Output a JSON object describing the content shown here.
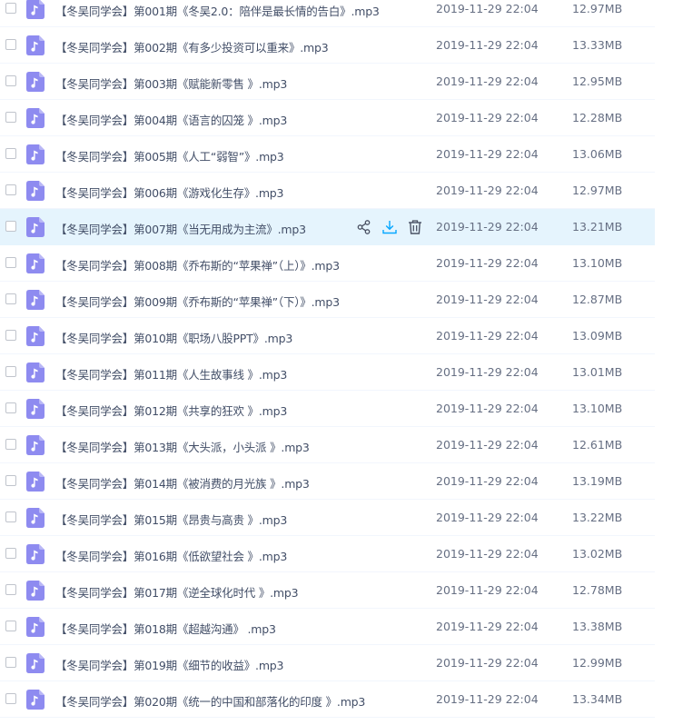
{
  "colors": {
    "accent": "#8E8BF0",
    "hover_bg": "#E5F4FD",
    "download_blue": "#06A7FF",
    "icon_gray": "#4A5163"
  },
  "file_icon": "music-file-icon",
  "hover_actions": [
    "share-icon",
    "download-icon",
    "delete-icon"
  ],
  "files": [
    {
      "name": "【冬吴同学会】第001期《冬吴2.0：陪伴是最长情的告白》.mp3",
      "date": "2019-11-29 22:04",
      "size": "12.97MB"
    },
    {
      "name": "【冬吴同学会】第002期《有多少投资可以重来》.mp3",
      "date": "2019-11-29 22:04",
      "size": "13.33MB"
    },
    {
      "name": "【冬吴同学会】第003期《赋能新零售 》.mp3",
      "date": "2019-11-29 22:04",
      "size": "12.95MB"
    },
    {
      "name": "【冬吴同学会】第004期《语言的囚笼 》.mp3",
      "date": "2019-11-29 22:04",
      "size": "12.28MB"
    },
    {
      "name": "【冬吴同学会】第005期《人工“弱智”》.mp3",
      "date": "2019-11-29 22:04",
      "size": "13.06MB"
    },
    {
      "name": "【冬吴同学会】第006期《游戏化生存》.mp3",
      "date": "2019-11-29 22:04",
      "size": "12.97MB"
    },
    {
      "name": "【冬吴同学会】第007期《当无用成为主流》.mp3",
      "date": "2019-11-29 22:04",
      "size": "13.21MB",
      "hover": true
    },
    {
      "name": "【冬吴同学会】第008期《乔布斯的“苹果禅”（上）》.mp3",
      "date": "2019-11-29 22:04",
      "size": "13.10MB"
    },
    {
      "name": "【冬吴同学会】第009期《乔布斯的“苹果禅”（下）》.mp3",
      "date": "2019-11-29 22:04",
      "size": "12.87MB"
    },
    {
      "name": "【冬吴同学会】第010期《职场八股PPT》.mp3",
      "date": "2019-11-29 22:04",
      "size": "13.09MB"
    },
    {
      "name": "【冬吴同学会】第011期《人生故事线 》.mp3",
      "date": "2019-11-29 22:04",
      "size": "13.01MB"
    },
    {
      "name": "【冬吴同学会】第012期《共享的狂欢 》.mp3",
      "date": "2019-11-29 22:04",
      "size": "13.10MB"
    },
    {
      "name": "【冬吴同学会】第013期《大头派，小头派 》.mp3",
      "date": "2019-11-29 22:04",
      "size": "12.61MB"
    },
    {
      "name": "【冬吴同学会】第014期《被消费的月光族 》.mp3",
      "date": "2019-11-29 22:04",
      "size": "13.19MB"
    },
    {
      "name": "【冬吴同学会】第015期《昂贵与高贵 》.mp3",
      "date": "2019-11-29 22:04",
      "size": "13.22MB"
    },
    {
      "name": "【冬吴同学会】第016期《低欲望社会 》.mp3",
      "date": "2019-11-29 22:04",
      "size": "13.02MB"
    },
    {
      "name": "【冬吴同学会】第017期《逆全球化时代 》.mp3",
      "date": "2019-11-29 22:04",
      "size": "12.78MB"
    },
    {
      "name": "【冬吴同学会】第018期《超越沟通》 .mp3",
      "date": "2019-11-29 22:04",
      "size": "13.38MB"
    },
    {
      "name": "【冬吴同学会】第019期《细节的收益》.mp3",
      "date": "2019-11-29 22:04",
      "size": "12.99MB"
    },
    {
      "name": "【冬吴同学会】第020期《统一的中国和部落化的印度 》.mp3",
      "date": "2019-11-29 22:04",
      "size": "13.34MB"
    }
  ]
}
